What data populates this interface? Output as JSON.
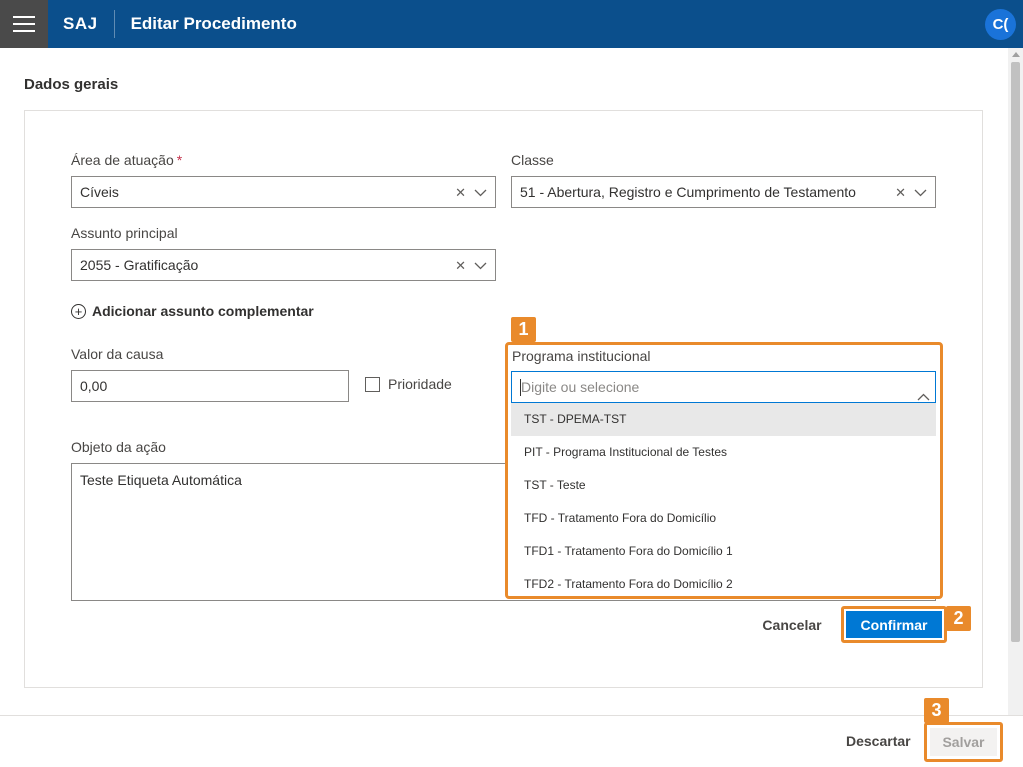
{
  "header": {
    "brand": "SAJ",
    "title": "Editar Procedimento",
    "user_initials": "C("
  },
  "section": {
    "title": "Dados gerais"
  },
  "form": {
    "area": {
      "label": "Área de atuação",
      "required_mark": "*",
      "value": "Cíveis"
    },
    "classe": {
      "label": "Classe",
      "value": "51 - Abertura, Registro e Cumprimento de Testamento"
    },
    "assunto": {
      "label": "Assunto principal",
      "value": "2055 - Gratificação"
    },
    "add_assunto_label": "Adicionar assunto complementar",
    "valor": {
      "label": "Valor da causa",
      "value": "0,00"
    },
    "prioridade": {
      "label": "Prioridade",
      "checked": false
    },
    "objeto": {
      "label": "Objeto da ação",
      "value": "Teste Etiqueta Automática"
    },
    "programa": {
      "label": "Programa institucional",
      "placeholder": "Digite ou selecione",
      "options": [
        "TST - DPEMA-TST",
        "PIT - Programa Institucional de Testes",
        "TST - Teste",
        "TFD - Tratamento Fora do Domicílio",
        "TFD1 - Tratamento Fora do Domicílio 1",
        "TFD2 - Tratamento Fora do Domicílio 2"
      ],
      "highlighted_option": "TST - DPEMA-TST"
    }
  },
  "actions": {
    "cancel_label": "Cancelar",
    "confirm_label": "Confirmar",
    "discard_label": "Descartar",
    "save_label": "Salvar"
  },
  "annotations": {
    "step1": "1",
    "step2": "2",
    "step3": "3"
  },
  "colors": {
    "header_bg": "#0b4f8c",
    "primary": "#0078d4",
    "highlight": "#e98a2b"
  }
}
